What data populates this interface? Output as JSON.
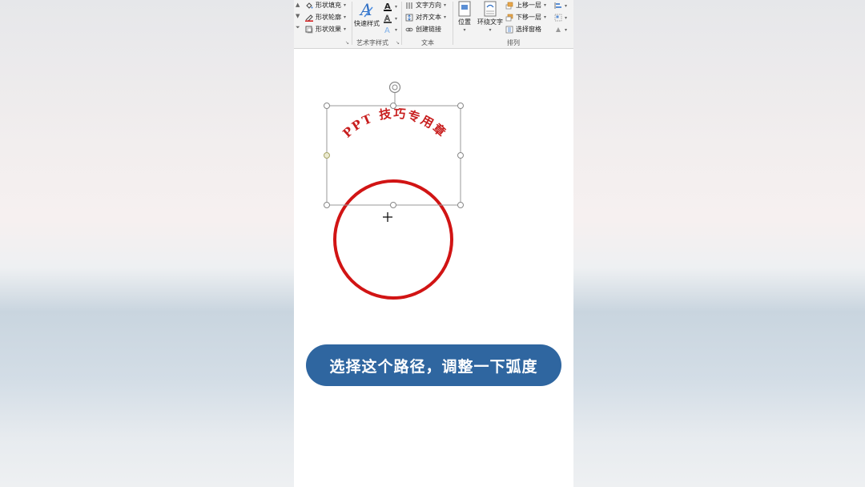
{
  "ribbon": {
    "shape_styles": {
      "fill_label": "形状填充",
      "outline_label": "形状轮廓",
      "effects_label": "形状效果"
    },
    "wordart": {
      "quick_styles_label": "快速样式",
      "group_label": "艺术字样式"
    },
    "text": {
      "direction_label": "文字方向",
      "align_label": "对齐文本",
      "link_label": "创建链接",
      "group_label": "文本"
    },
    "arrange": {
      "position_label": "位置",
      "wrap_label": "环绕文字",
      "bring_forward_label": "上移一层",
      "send_backward_label": "下移一层",
      "selection_pane_label": "选择窗格",
      "group_label": "排列"
    }
  },
  "document": {
    "wordart_text": "PPT 技巧专用章",
    "wordart_color": "#c81e1e",
    "circle_color": "#d11414"
  },
  "caption": {
    "text": "选择这个路径，调整一下弧度",
    "background": "#2f66a0"
  }
}
